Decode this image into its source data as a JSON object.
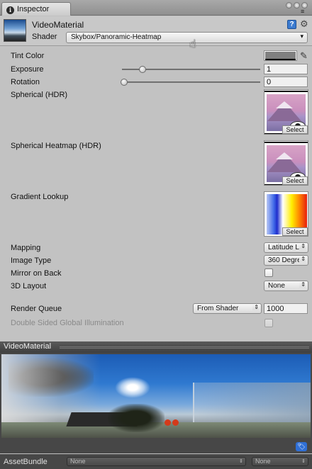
{
  "tab": {
    "title": "Inspector"
  },
  "header": {
    "material_name": "VideoMaterial",
    "shader_label": "Shader",
    "shader_value": "Skybox/Panoramic-Heatmap"
  },
  "properties": {
    "tint_color": {
      "label": "Tint Color",
      "color": "#808080"
    },
    "exposure": {
      "label": "Exposure",
      "value": "1",
      "slider_fraction": 0.14
    },
    "rotation": {
      "label": "Rotation",
      "value": "0",
      "slider_fraction": 0.0
    },
    "spherical": {
      "label": "Spherical  (HDR)",
      "select": "Select"
    },
    "spherical_heatmap": {
      "label": "Spherical Heatmap  (HDR)",
      "select": "Select"
    },
    "gradient_lookup": {
      "label": "Gradient Lookup",
      "select": "Select"
    },
    "mapping": {
      "label": "Mapping",
      "value": "Latitude Lo"
    },
    "image_type": {
      "label": "Image Type",
      "value": "360 Degre"
    },
    "mirror_on_back": {
      "label": "Mirror on Back",
      "checked": false
    },
    "layout_3d": {
      "label": "3D Layout",
      "value": "None"
    }
  },
  "render_queue": {
    "label": "Render Queue",
    "source": "From Shader",
    "value": "1000"
  },
  "double_sided_gi": {
    "label": "Double Sided Global Illumination",
    "checked": false
  },
  "preview": {
    "title": "VideoMaterial"
  },
  "asset_bundle": {
    "label": "AssetBundle",
    "name": "None",
    "variant": "None"
  }
}
